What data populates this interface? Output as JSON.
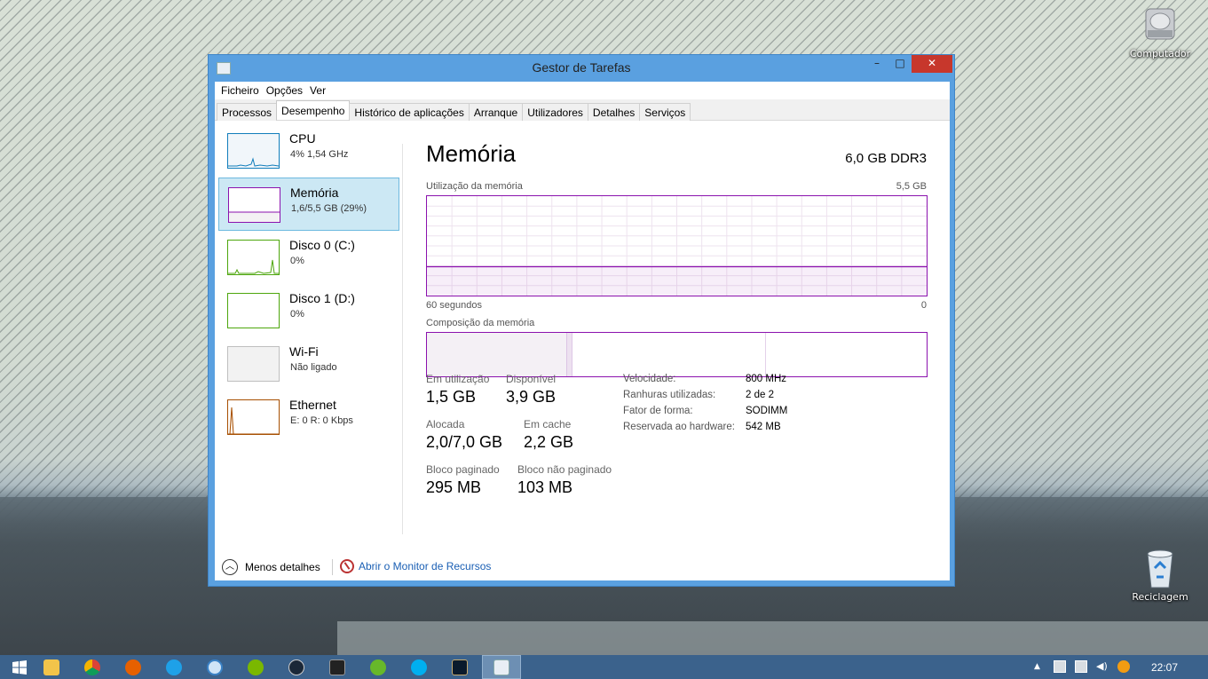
{
  "desktop": {
    "icons": [
      {
        "label": "Computador",
        "icon": "hard-drive-icon"
      },
      {
        "label": "Reciclagem",
        "icon": "recycle-bin-icon"
      }
    ]
  },
  "window": {
    "title": "Gestor de Tarefas",
    "controls": {
      "minimize": "–",
      "maximize": "□",
      "close": "✕"
    },
    "menu": [
      "Ficheiro",
      "Opções",
      "Ver"
    ],
    "tabs": [
      "Processos",
      "Desempenho",
      "Histórico de aplicações",
      "Arranque",
      "Utilizadores",
      "Detalhes",
      "Serviços"
    ],
    "active_tab": "Desempenho"
  },
  "sidebar": {
    "items": [
      {
        "name": "CPU",
        "sub": "4% 1,54 GHz",
        "color": "#117dbb",
        "fill": "#f1f6fa"
      },
      {
        "name": "Memória",
        "sub": "1,6/5,5 GB (29%)",
        "color": "#8b12ae",
        "fill": "#f4f2f4"
      },
      {
        "name": "Disco 0 (C:)",
        "sub": "0%",
        "color": "#4da60c",
        "fill": "#eff7e9"
      },
      {
        "name": "Disco 1 (D:)",
        "sub": "0%",
        "color": "#4da60c",
        "fill": "#eff7e9"
      },
      {
        "name": "Wi-Fi",
        "sub": "Não ligado",
        "color": "#bfbfbf",
        "fill": "#f2f2f2"
      },
      {
        "name": "Ethernet",
        "sub": "E: 0 R: 0 Kbps",
        "color": "#a74f01",
        "fill": "#fcf3eb"
      }
    ],
    "active": "Memória"
  },
  "memory": {
    "title": "Memória",
    "type": "6,0 GB DDR3",
    "usage_label": "Utilização da memória",
    "usage_max": "5,5 GB",
    "axis_left": "60 segundos",
    "axis_right": "0",
    "usage_fraction": 0.29,
    "composition_label": "Composição da memória",
    "composition_fractions": [
      0.28,
      0.011,
      0.387,
      0.322
    ],
    "stats": {
      "in_use": {
        "label": "Em utilização",
        "value": "1,5 GB"
      },
      "available": {
        "label": "Disponível",
        "value": "3,9 GB"
      },
      "committed": {
        "label": "Alocada",
        "value": "2,0/7,0 GB"
      },
      "cached": {
        "label": "Em cache",
        "value": "2,2 GB"
      },
      "paged_pool": {
        "label": "Bloco paginado",
        "value": "295 MB"
      },
      "nonpaged_pool": {
        "label": "Bloco não paginado",
        "value": "103 MB"
      }
    },
    "details": [
      {
        "k": "Velocidade:",
        "v": "800 MHz"
      },
      {
        "k": "Ranhuras utilizadas:",
        "v": "2 de 2"
      },
      {
        "k": "Fator de forma:",
        "v": "SODIMM"
      },
      {
        "k": "Reservada ao hardware:",
        "v": "542 MB"
      }
    ]
  },
  "footer": {
    "less_details": "Menos detalhes",
    "resource_monitor": "Abrir o Monitor de Recursos"
  },
  "taskbar": {
    "apps": [
      "start-icon",
      "file-explorer-icon",
      "chrome-icon",
      "firefox-icon",
      "internet-explorer-icon",
      "itunes-icon",
      "spotify-icon",
      "steam-icon",
      "terminal-icon",
      "utorrent-icon",
      "skype-icon",
      "league-of-legends-icon",
      "task-manager-icon"
    ],
    "clock": "22:07"
  }
}
